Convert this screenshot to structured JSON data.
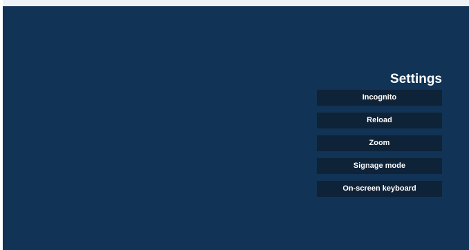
{
  "settings": {
    "title": "Settings",
    "items": [
      {
        "label": "Incognito"
      },
      {
        "label": "Reload"
      },
      {
        "label": "Zoom"
      },
      {
        "label": "Signage mode"
      },
      {
        "label": "On-screen keyboard"
      }
    ]
  },
  "colors": {
    "background": "#113355",
    "button_background": "#0e2238",
    "text": "#ffffff"
  }
}
